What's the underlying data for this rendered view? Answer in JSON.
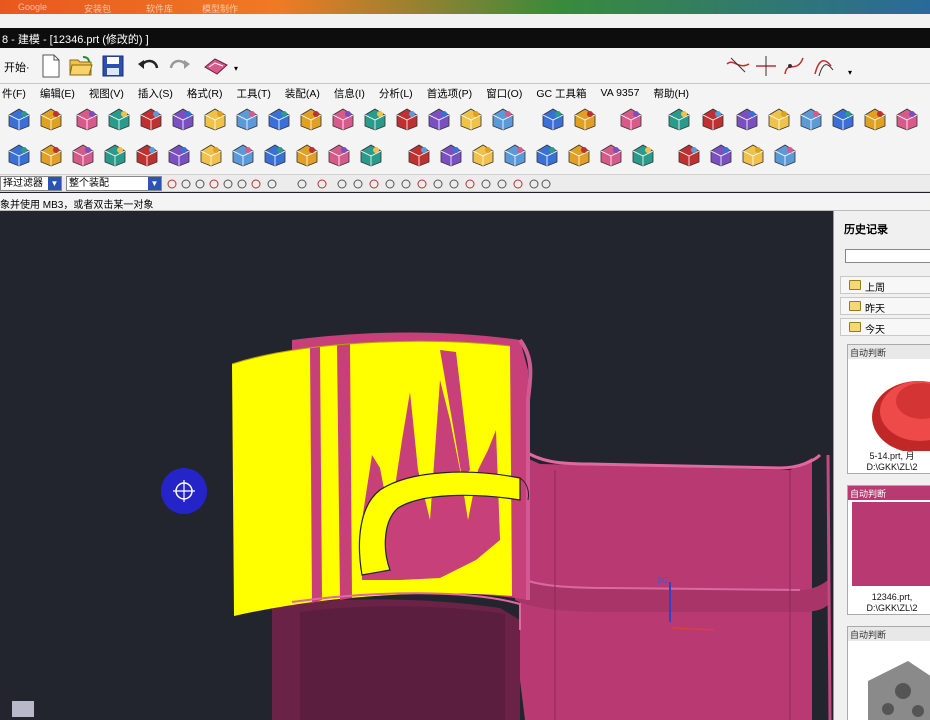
{
  "os": {
    "items": [
      "Google",
      "安装包",
      "软件库",
      "模型制作"
    ]
  },
  "window": {
    "title": "8 - 建模 - [12346.prt  (修改的) ]"
  },
  "toolbar": {
    "start_label": "开始·"
  },
  "menu": [
    "件(F)",
    "编辑(E)",
    "视图(V)",
    "插入(S)",
    "格式(R)",
    "工具(T)",
    "装配(A)",
    "信息(I)",
    "分析(L)",
    "首选项(P)",
    "窗口(O)",
    "GC 工具箱",
    "VA 9357",
    "帮助(H)"
  ],
  "filter": {
    "type_filter": "择过滤器",
    "scope": "整个装配"
  },
  "status": {
    "prompt": "象并使用 MB3，或者双击某一对象"
  },
  "viewport": {
    "axis_label": "ZC"
  },
  "history": {
    "title": "历史记录",
    "groups": [
      "上周",
      "昨天",
      "今天"
    ],
    "cards": [
      {
        "header": "自动判断",
        "name1": "5-14.prt,  月",
        "name2": "D:\\GKK\\ZL\\2"
      },
      {
        "header": "自动判断",
        "name1": "12346.prt,",
        "name2": "D:\\GKK\\ZL\\2"
      },
      {
        "header": "自动判断",
        "name1": "",
        "name2": ""
      }
    ]
  },
  "colors": {
    "yellow_face": "#ffff00",
    "magenta_body": "#c7407a",
    "background": "#22252d",
    "cursor": "#2424c8"
  }
}
